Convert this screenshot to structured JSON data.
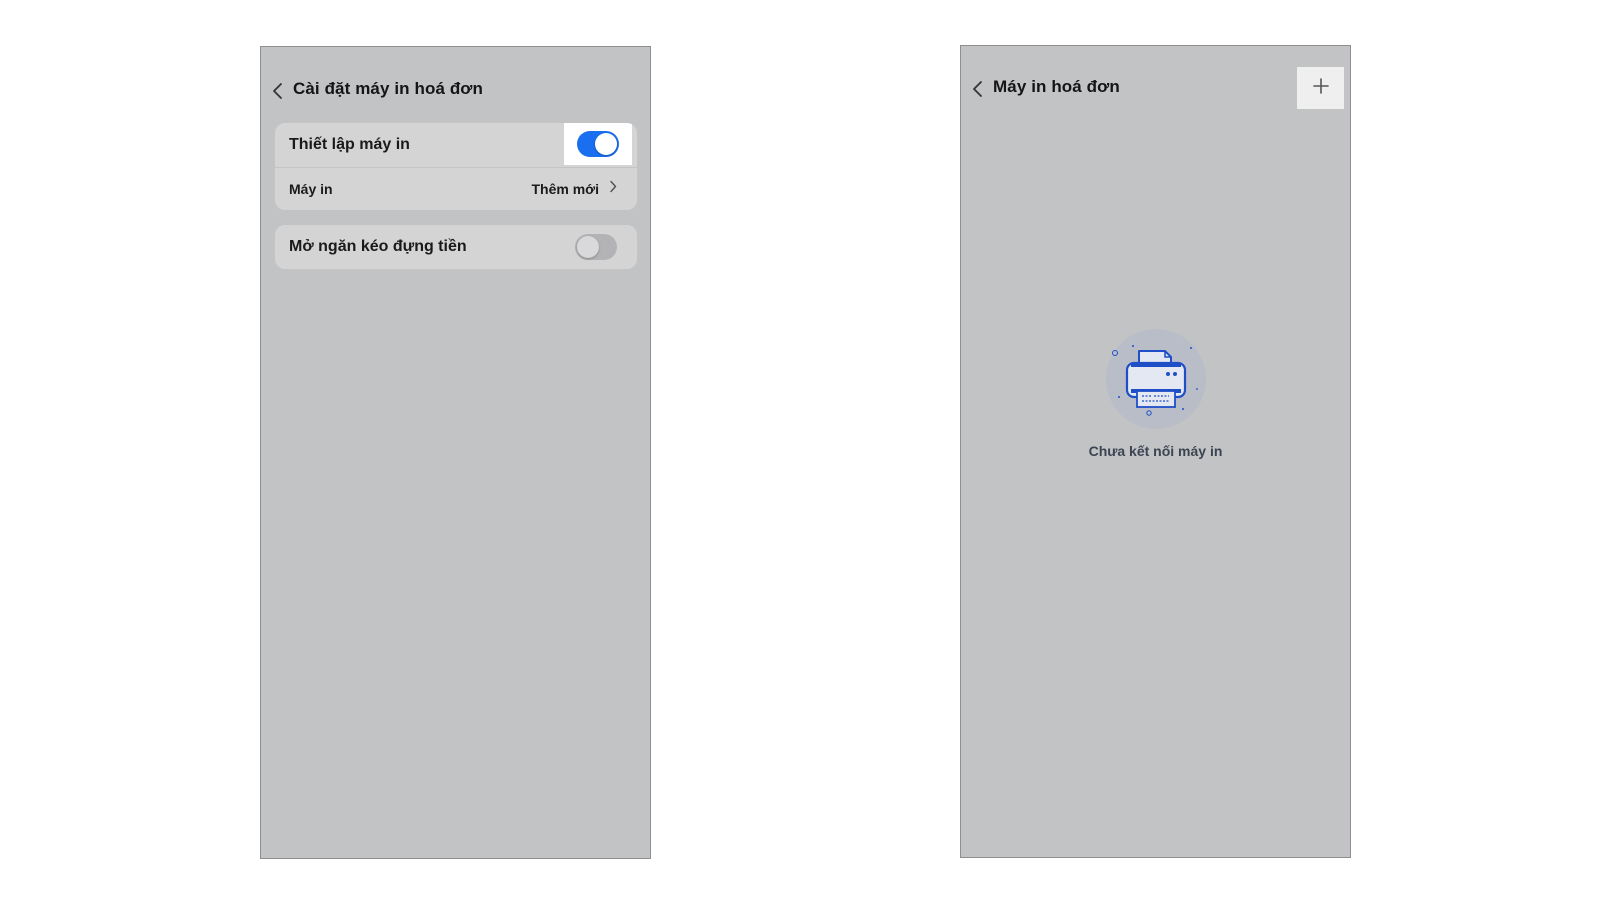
{
  "settings_screen": {
    "title": "Cài đặt máy in hoá đơn",
    "printer_setup": {
      "label": "Thiết lập máy in",
      "enabled": true
    },
    "printer_row": {
      "label": "Máy in",
      "value": "Thêm mới"
    },
    "cash_drawer": {
      "label": "Mở ngăn kéo đựng tiền",
      "enabled": false
    }
  },
  "printer_list_screen": {
    "title": "Máy in hoá đơn",
    "empty_message": "Chưa kết nối máy in"
  },
  "colors": {
    "toggle_on": "#1a6ef0",
    "accent_icon": "#1f4fc7",
    "screen_background": "#c2c3c5"
  },
  "icons": {
    "back": "chevron-left-icon",
    "disclosure": "chevron-right-icon",
    "add": "plus-icon",
    "illustration": "printer-icon"
  }
}
